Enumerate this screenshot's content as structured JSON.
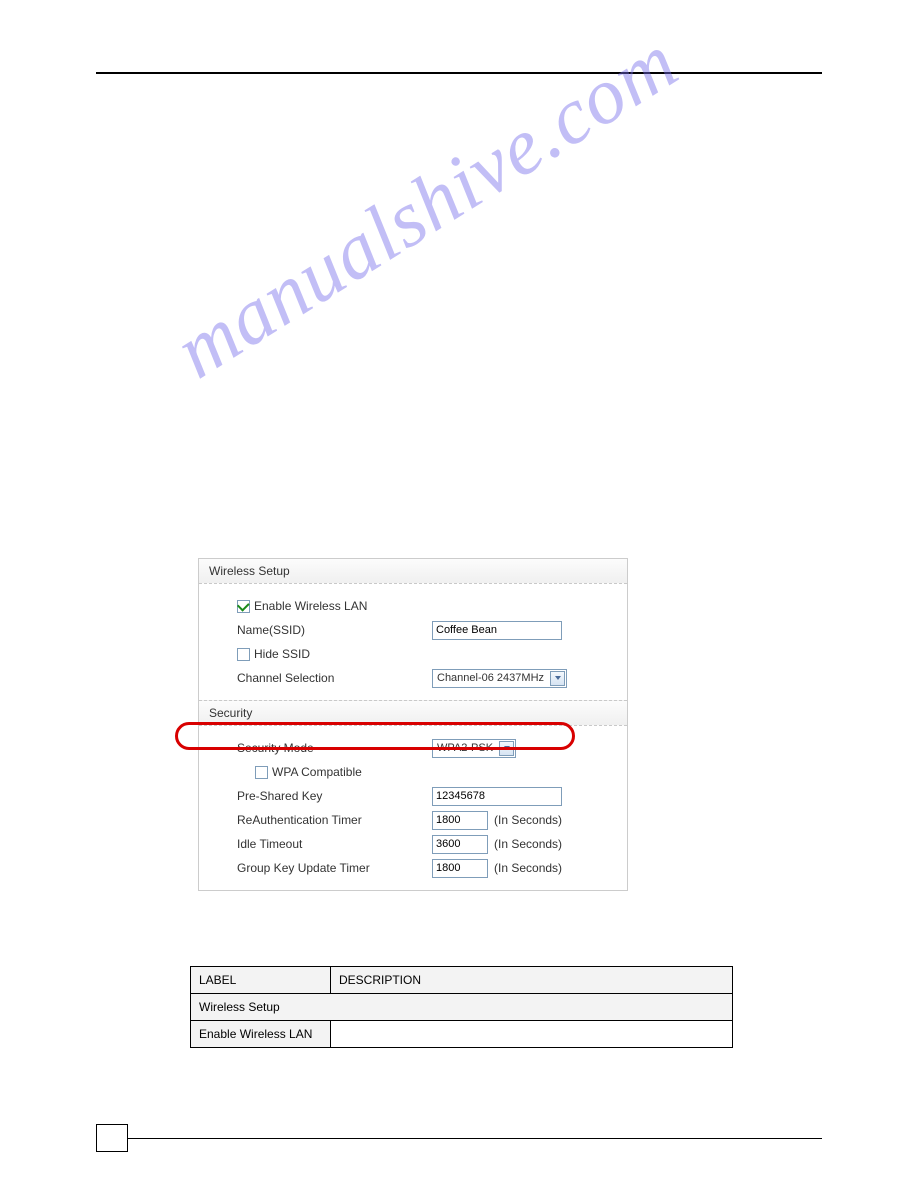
{
  "watermark": "manualshive.com",
  "panel": {
    "wireless_setup": {
      "title": "Wireless Setup",
      "enable_wlan_label": "Enable Wireless LAN",
      "ssid_label": "Name(SSID)",
      "ssid_value": "Coffee Bean",
      "hide_ssid_label": "Hide SSID",
      "channel_label": "Channel Selection",
      "channel_value": "Channel-06 2437MHz"
    },
    "security": {
      "title": "Security",
      "mode_label": "Security Mode",
      "mode_value": "WPA2-PSK",
      "wpa_compat_label": "WPA Compatible",
      "psk_label": "Pre-Shared Key",
      "psk_value": "12345678",
      "reauth_label": "ReAuthentication Timer",
      "reauth_value": "1800",
      "reauth_unit": "(In Seconds)",
      "idle_label": "Idle Timeout",
      "idle_value": "3600",
      "idle_unit": "(In Seconds)",
      "gkey_label": "Group Key Update Timer",
      "gkey_value": "1800",
      "gkey_unit": "(In Seconds)"
    }
  },
  "desc_table": {
    "col_label": "LABEL",
    "col_desc": "DESCRIPTION",
    "section": "Wireless Setup",
    "row1_label": "Enable Wireless LAN"
  }
}
